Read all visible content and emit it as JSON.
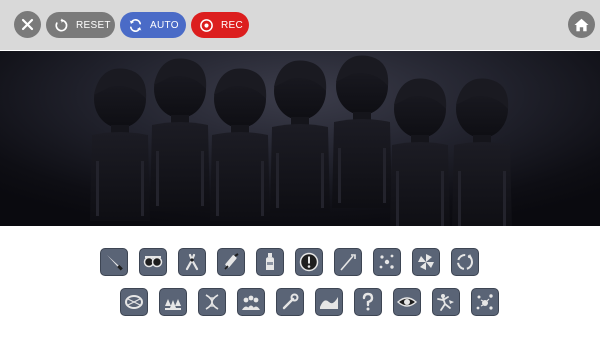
{
  "toolbar": {
    "close_icon": "close-icon",
    "reset_label": "RESET",
    "reset_icon": "reset-icon",
    "auto_label": "AUTO",
    "auto_icon": "sync-icon",
    "rec_label": "REC",
    "rec_icon": "record-icon",
    "home_icon": "home-icon",
    "colors": {
      "bar": "#d9d9d9",
      "gray_button": "#7a7a7a",
      "auto": "#4a6bc7",
      "rec": "#dc1e1e"
    }
  },
  "stage": {
    "performers": 7,
    "performer_icon": "silhouette-figure",
    "colors": {
      "stage_top": "#3c3d4b",
      "stage_bottom": "#0a0a0f",
      "silhouette": "#16161c"
    }
  },
  "palette": {
    "row1": [
      {
        "icon": "knife-icon"
      },
      {
        "icon": "goggles-icon"
      },
      {
        "icon": "pliers-icon"
      },
      {
        "icon": "syringe-icon"
      },
      {
        "icon": "bottle-icon"
      },
      {
        "icon": "alert-icon"
      },
      {
        "icon": "grappling-hook-icon"
      },
      {
        "icon": "scatter-icon"
      },
      {
        "icon": "pinwheel-icon"
      },
      {
        "icon": "cycle-icon"
      }
    ],
    "row2": [
      {
        "icon": "rope-icon"
      },
      {
        "icon": "creatures-icon"
      },
      {
        "icon": "dna-icon"
      },
      {
        "icon": "crowd-icon"
      },
      {
        "icon": "wrench-icon"
      },
      {
        "icon": "wave-icon"
      },
      {
        "icon": "question-icon"
      },
      {
        "icon": "eye-icon"
      },
      {
        "icon": "dancer-icon"
      },
      {
        "icon": "splash-icon"
      }
    ]
  }
}
